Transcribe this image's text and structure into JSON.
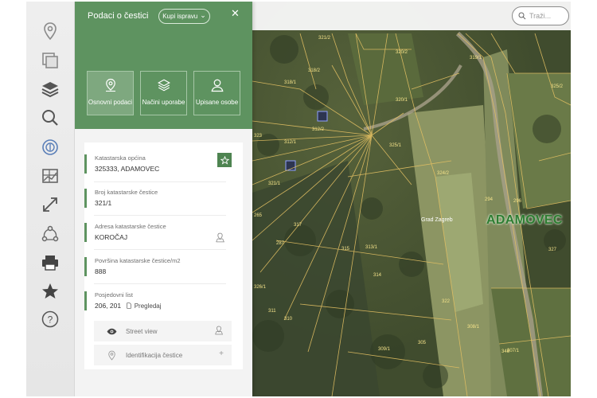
{
  "panel": {
    "title": "Podaci o čestici",
    "buy_label": "Kupi ispravu",
    "buy_chevron": "⌄",
    "close_glyph": "✕",
    "tabs": [
      {
        "label": "Osnovni podaci",
        "icon": "map-pin-icon",
        "active": true
      },
      {
        "label": "Načini uporabe",
        "icon": "layers-icon",
        "active": false
      },
      {
        "label": "Upisane osobe",
        "icon": "person-icon",
        "active": false
      }
    ]
  },
  "details": {
    "opcina_label": "Katastarska općina",
    "opcina_value": "325333, ADAMOVEC",
    "broj_label": "Broj katastarske čestice",
    "broj_value": "321/1",
    "adresa_label": "Adresa katastarske čestice",
    "adresa_value": "KOROČAJ",
    "povrsina_label": "Površina katastarske čestice/m2",
    "povrsina_value": "888",
    "posjedovni_label": "Posjedovni list",
    "posjedovni_value": "206, 201",
    "pregledaj_label": "Pregledaj"
  },
  "actions": {
    "street_view": "Street view",
    "identifikacija": "Identifikacija čestice",
    "plus": "+"
  },
  "rail": [
    "location-pin-icon",
    "copy-windows-icon",
    "layers-icon",
    "search-icon",
    "cadastre-badge-icon",
    "map-grid-icon",
    "expand-arrows-icon",
    "share-icon",
    "printer-icon",
    "star-icon",
    "help-icon"
  ],
  "search": {
    "placeholder": "Traži..."
  },
  "map": {
    "place_label": "ADAMOVEC",
    "poi_label": "Grad Zagreb",
    "parcels": [
      "321/2",
      "320/2",
      "319/1",
      "320/1",
      "318/1",
      "318/2",
      "325/1",
      "324/2",
      "325/2",
      "294",
      "296",
      "313/1",
      "317",
      "315",
      "314",
      "309/1",
      "312/1",
      "312/2",
      "308/1",
      "307/1",
      "327",
      "322",
      "323",
      "321/1",
      "265",
      "287",
      "346",
      "305",
      "311",
      "310",
      "326/1"
    ]
  },
  "colors": {
    "brand": "#5e9360",
    "brand_dark": "#4e8451",
    "parcel_line": "#e3c063",
    "place_label": "#2e7d32"
  }
}
